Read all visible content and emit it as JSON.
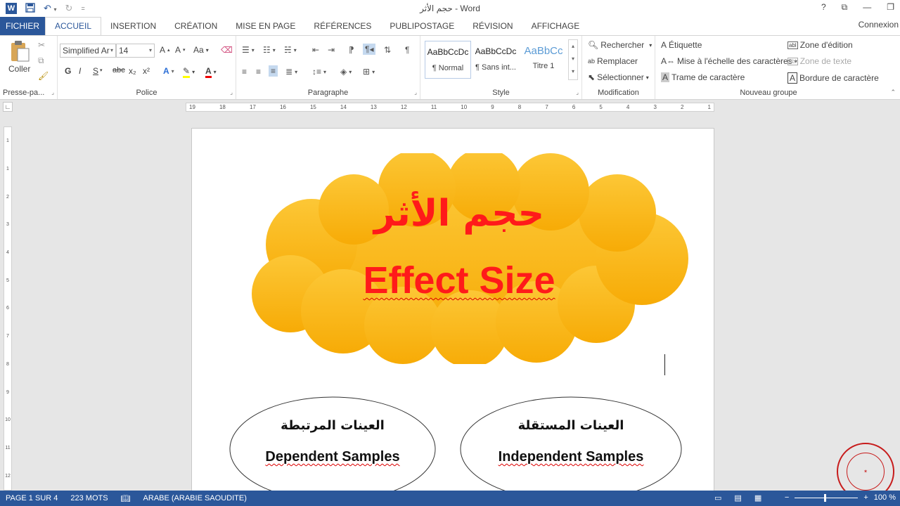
{
  "window": {
    "title": "حجم الأثر - Word",
    "sign_in": "Connexion",
    "controls": [
      "?",
      "⧉",
      "—",
      "❐"
    ]
  },
  "quick_access": {
    "app_icon": "W",
    "items": [
      "save-icon",
      "undo-icon",
      "redo-icon",
      "customize-icon"
    ]
  },
  "tabs": [
    "FICHIER",
    "ACCUEIL",
    "INSERTION",
    "CRÉATION",
    "MISE EN PAGE",
    "RÉFÉRENCES",
    "PUBLIPOSTAGE",
    "RÉVISION",
    "AFFICHAGE"
  ],
  "ribbon": {
    "clipboard": {
      "paste": "Coller",
      "label": "Presse-pa..."
    },
    "font": {
      "name": "Simplified Ar",
      "size": "14",
      "bold": "G",
      "italic": "I",
      "underline": "S",
      "strike": "abc",
      "sub": "x₂",
      "sup": "x²",
      "label": "Police"
    },
    "paragraph": {
      "label": "Paragraphe",
      "pilcrow": "¶"
    },
    "styles": {
      "items": [
        {
          "sample": "AaBbCcDc",
          "name": "¶ Normal"
        },
        {
          "sample": "AaBbCcDc",
          "name": "¶ Sans int..."
        },
        {
          "sample": "AaBbCc",
          "name": "Titre 1"
        }
      ],
      "label": "Style"
    },
    "editing": {
      "find": "Rechercher",
      "replace": "Remplacer",
      "select": "Sélectionner",
      "label": "Modification"
    },
    "new_group": {
      "items": [
        "Étiquette",
        "Mise à l'échelle des caractères",
        "Trame de caractère",
        "Zone d'édition",
        "Zone de texte",
        "Bordure de caractère"
      ],
      "label": "Nouveau groupe"
    }
  },
  "ruler": {
    "marks": [
      "19",
      "18",
      "17",
      "16",
      "15",
      "14",
      "13",
      "12",
      "11",
      "10",
      "9",
      "8",
      "7",
      "6",
      "5",
      "4",
      "3",
      "2",
      "1"
    ],
    "vertical_marks": [
      "1",
      "1",
      "2",
      "3",
      "4",
      "5",
      "6",
      "7",
      "8",
      "9",
      "10",
      "11",
      "12"
    ]
  },
  "document": {
    "cloud_title_ar": "حجم الأثر",
    "cloud_title_en": "Effect Size",
    "left_ellipse": {
      "ar": "العينات المرتبطة",
      "en": "Dependent Samples"
    },
    "right_ellipse": {
      "ar": "العينات المستقلة",
      "en": "Independent Samples"
    }
  },
  "status": {
    "page": "PAGE 1 SUR 4",
    "words": "223 MOTS",
    "language": "ARABE (ARABIE SAOUDITE)",
    "zoom": "100 %"
  },
  "colors": {
    "accent": "#2b579a",
    "cloud": "#fcb91c",
    "title_red": "#ff1a1a",
    "stamp": "#c71c1c"
  }
}
